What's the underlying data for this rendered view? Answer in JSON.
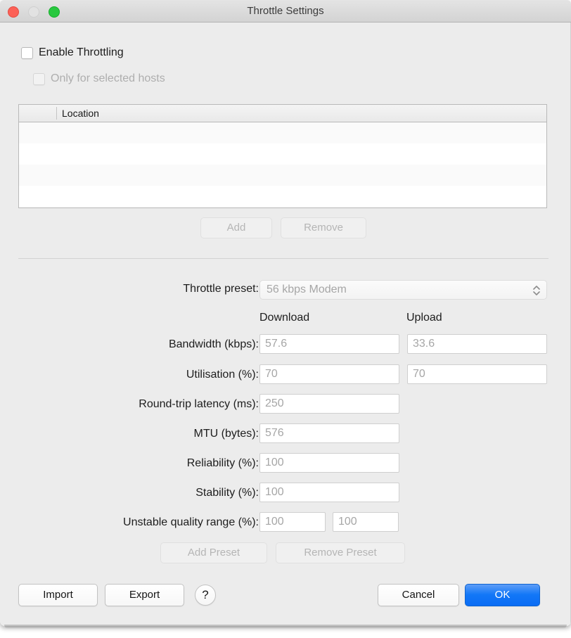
{
  "window": {
    "title": "Throttle Settings",
    "traffic_lights": [
      "close",
      "minimize",
      "maximize"
    ]
  },
  "options": {
    "enable_throttling": {
      "label": "Enable Throttling",
      "checked": false,
      "enabled": true
    },
    "only_selected_hosts": {
      "label": "Only for selected hosts",
      "checked": false,
      "enabled": false
    }
  },
  "hosts_table": {
    "columns": [
      "",
      "Location"
    ],
    "rows": [],
    "add_label": "Add",
    "remove_label": "Remove",
    "add_enabled": false,
    "remove_enabled": false
  },
  "preset": {
    "label": "Throttle preset:",
    "value": "56 kbps Modem",
    "enabled": false
  },
  "columns": {
    "download": "Download",
    "upload": "Upload"
  },
  "fields": [
    {
      "label": "Bandwidth (kbps):",
      "download": "57.6",
      "upload": "33.6"
    },
    {
      "label": "Utilisation (%):",
      "download": "70",
      "upload": "70"
    },
    {
      "label": "Round-trip latency (ms):",
      "download": "250",
      "upload": null
    },
    {
      "label": "MTU (bytes):",
      "download": "576",
      "upload": null
    },
    {
      "label": "Reliability (%):",
      "download": "100",
      "upload": null
    },
    {
      "label": "Stability (%):",
      "download": "100",
      "upload": null
    },
    {
      "label": "Unstable quality range (%):",
      "download": "100",
      "upload": "100"
    }
  ],
  "preset_buttons": {
    "add_label": "Add Preset",
    "remove_label": "Remove Preset",
    "add_enabled": false,
    "remove_enabled": false
  },
  "footer": {
    "import_label": "Import",
    "export_label": "Export",
    "help_label": "?",
    "cancel_label": "Cancel",
    "ok_label": "OK"
  },
  "colors": {
    "accent": "#0a6cf4",
    "close": "#fc6157",
    "minimize": "#e2e2e2",
    "maximize": "#28c83f",
    "window_bg": "#ececec",
    "disabled_text": "#b5b5b5"
  }
}
